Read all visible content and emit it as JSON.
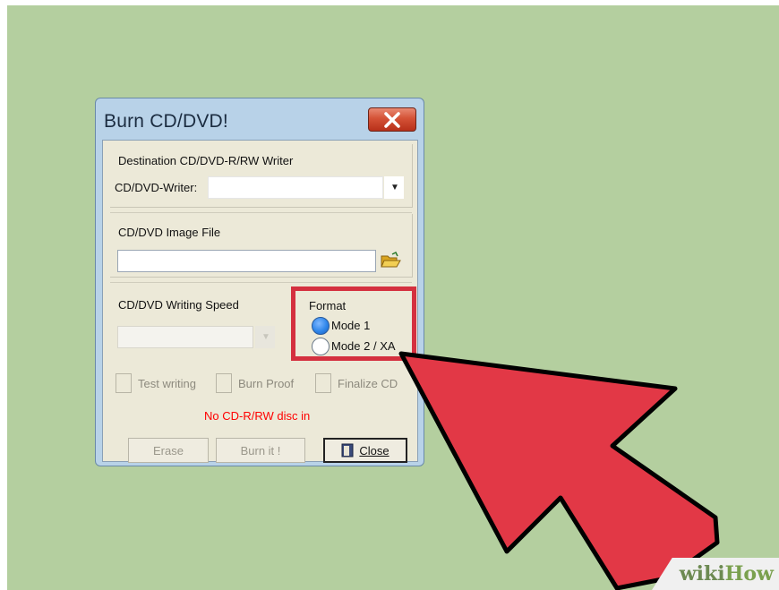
{
  "dialog": {
    "title": "Burn CD/DVD!",
    "close_icon": "close-x-icon"
  },
  "destination": {
    "group_label": "Destination CD/DVD-R/RW Writer",
    "writer_label": "CD/DVD-Writer:",
    "writer_value": ""
  },
  "image_file": {
    "group_label": "CD/DVD Image File",
    "path_value": "",
    "browse_icon": "folder-open-icon"
  },
  "speed": {
    "group_label": "CD/DVD Writing Speed",
    "value": ""
  },
  "format": {
    "group_label": "Format",
    "options": [
      "Mode 1",
      "Mode 2 / XA"
    ],
    "selected": "Mode 1"
  },
  "options": {
    "test_writing": "Test writing",
    "burn_proof": "Burn Proof",
    "finalize_cd": "Finalize CD"
  },
  "status": {
    "text": "No CD-R/RW disc in",
    "color": "#ff0000"
  },
  "buttons": {
    "erase": "Erase",
    "burn": "Burn it !",
    "close": "Close",
    "close_icon": "door-icon"
  },
  "annotation": {
    "highlight_color": "#d4303f",
    "arrow_color": "#e23846"
  },
  "watermark": {
    "wiki": "wiki",
    "how": "How"
  }
}
